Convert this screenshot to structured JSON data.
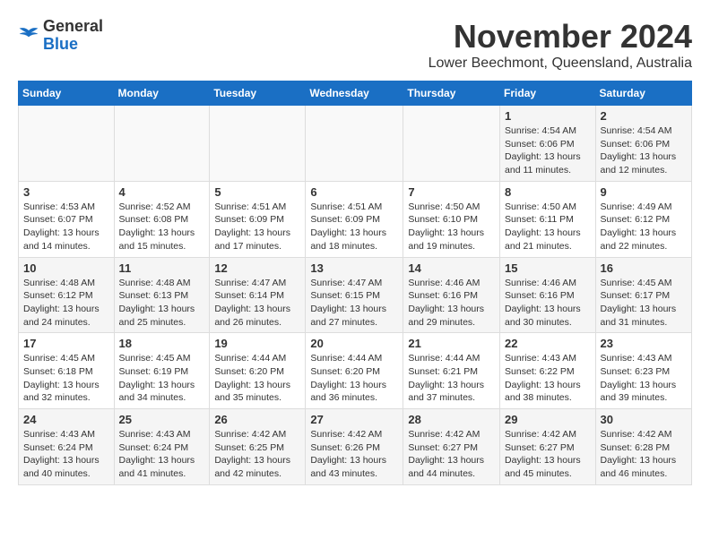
{
  "logo": {
    "general": "General",
    "blue": "Blue"
  },
  "header": {
    "month": "November 2024",
    "location": "Lower Beechmont, Queensland, Australia"
  },
  "weekdays": [
    "Sunday",
    "Monday",
    "Tuesday",
    "Wednesday",
    "Thursday",
    "Friday",
    "Saturday"
  ],
  "weeks": [
    [
      {
        "day": "",
        "info": ""
      },
      {
        "day": "",
        "info": ""
      },
      {
        "day": "",
        "info": ""
      },
      {
        "day": "",
        "info": ""
      },
      {
        "day": "",
        "info": ""
      },
      {
        "day": "1",
        "info": "Sunrise: 4:54 AM\nSunset: 6:06 PM\nDaylight: 13 hours and 11 minutes."
      },
      {
        "day": "2",
        "info": "Sunrise: 4:54 AM\nSunset: 6:06 PM\nDaylight: 13 hours and 12 minutes."
      }
    ],
    [
      {
        "day": "3",
        "info": "Sunrise: 4:53 AM\nSunset: 6:07 PM\nDaylight: 13 hours and 14 minutes."
      },
      {
        "day": "4",
        "info": "Sunrise: 4:52 AM\nSunset: 6:08 PM\nDaylight: 13 hours and 15 minutes."
      },
      {
        "day": "5",
        "info": "Sunrise: 4:51 AM\nSunset: 6:09 PM\nDaylight: 13 hours and 17 minutes."
      },
      {
        "day": "6",
        "info": "Sunrise: 4:51 AM\nSunset: 6:09 PM\nDaylight: 13 hours and 18 minutes."
      },
      {
        "day": "7",
        "info": "Sunrise: 4:50 AM\nSunset: 6:10 PM\nDaylight: 13 hours and 19 minutes."
      },
      {
        "day": "8",
        "info": "Sunrise: 4:50 AM\nSunset: 6:11 PM\nDaylight: 13 hours and 21 minutes."
      },
      {
        "day": "9",
        "info": "Sunrise: 4:49 AM\nSunset: 6:12 PM\nDaylight: 13 hours and 22 minutes."
      }
    ],
    [
      {
        "day": "10",
        "info": "Sunrise: 4:48 AM\nSunset: 6:12 PM\nDaylight: 13 hours and 24 minutes."
      },
      {
        "day": "11",
        "info": "Sunrise: 4:48 AM\nSunset: 6:13 PM\nDaylight: 13 hours and 25 minutes."
      },
      {
        "day": "12",
        "info": "Sunrise: 4:47 AM\nSunset: 6:14 PM\nDaylight: 13 hours and 26 minutes."
      },
      {
        "day": "13",
        "info": "Sunrise: 4:47 AM\nSunset: 6:15 PM\nDaylight: 13 hours and 27 minutes."
      },
      {
        "day": "14",
        "info": "Sunrise: 4:46 AM\nSunset: 6:16 PM\nDaylight: 13 hours and 29 minutes."
      },
      {
        "day": "15",
        "info": "Sunrise: 4:46 AM\nSunset: 6:16 PM\nDaylight: 13 hours and 30 minutes."
      },
      {
        "day": "16",
        "info": "Sunrise: 4:45 AM\nSunset: 6:17 PM\nDaylight: 13 hours and 31 minutes."
      }
    ],
    [
      {
        "day": "17",
        "info": "Sunrise: 4:45 AM\nSunset: 6:18 PM\nDaylight: 13 hours and 32 minutes."
      },
      {
        "day": "18",
        "info": "Sunrise: 4:45 AM\nSunset: 6:19 PM\nDaylight: 13 hours and 34 minutes."
      },
      {
        "day": "19",
        "info": "Sunrise: 4:44 AM\nSunset: 6:20 PM\nDaylight: 13 hours and 35 minutes."
      },
      {
        "day": "20",
        "info": "Sunrise: 4:44 AM\nSunset: 6:20 PM\nDaylight: 13 hours and 36 minutes."
      },
      {
        "day": "21",
        "info": "Sunrise: 4:44 AM\nSunset: 6:21 PM\nDaylight: 13 hours and 37 minutes."
      },
      {
        "day": "22",
        "info": "Sunrise: 4:43 AM\nSunset: 6:22 PM\nDaylight: 13 hours and 38 minutes."
      },
      {
        "day": "23",
        "info": "Sunrise: 4:43 AM\nSunset: 6:23 PM\nDaylight: 13 hours and 39 minutes."
      }
    ],
    [
      {
        "day": "24",
        "info": "Sunrise: 4:43 AM\nSunset: 6:24 PM\nDaylight: 13 hours and 40 minutes."
      },
      {
        "day": "25",
        "info": "Sunrise: 4:43 AM\nSunset: 6:24 PM\nDaylight: 13 hours and 41 minutes."
      },
      {
        "day": "26",
        "info": "Sunrise: 4:42 AM\nSunset: 6:25 PM\nDaylight: 13 hours and 42 minutes."
      },
      {
        "day": "27",
        "info": "Sunrise: 4:42 AM\nSunset: 6:26 PM\nDaylight: 13 hours and 43 minutes."
      },
      {
        "day": "28",
        "info": "Sunrise: 4:42 AM\nSunset: 6:27 PM\nDaylight: 13 hours and 44 minutes."
      },
      {
        "day": "29",
        "info": "Sunrise: 4:42 AM\nSunset: 6:27 PM\nDaylight: 13 hours and 45 minutes."
      },
      {
        "day": "30",
        "info": "Sunrise: 4:42 AM\nSunset: 6:28 PM\nDaylight: 13 hours and 46 minutes."
      }
    ]
  ]
}
